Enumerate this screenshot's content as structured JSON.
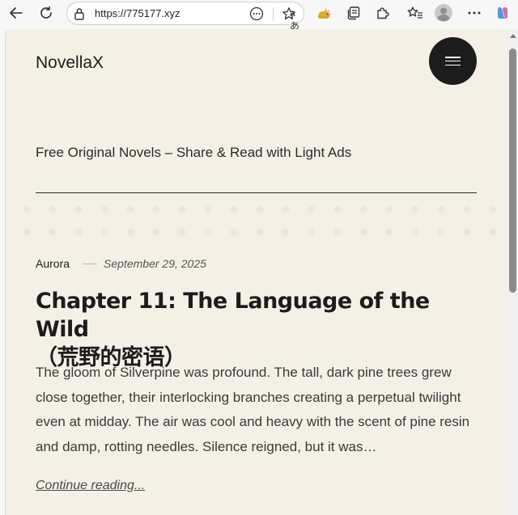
{
  "browser": {
    "url": "https://775177.xyz",
    "read_aloud_label": "aあ"
  },
  "site": {
    "title": "NovellaX",
    "tagline": "Free Original Novels – Share & Read with Light Ads"
  },
  "post": {
    "author": "Aurora",
    "date": "September 29, 2025",
    "title_line1": "Chapter 11: The Language of the Wild",
    "title_line2": "（荒野的密语）",
    "excerpt": "The gloom of Silverpine was profound. The tall, dark pine trees grew close together, their interlocking branches creating a perpetual twilight even at midday. The air was cool and heavy with the scent of pine resin and damp, rotting needles. Silence reigned, but it was…",
    "continue_label": "Continue reading..."
  }
}
